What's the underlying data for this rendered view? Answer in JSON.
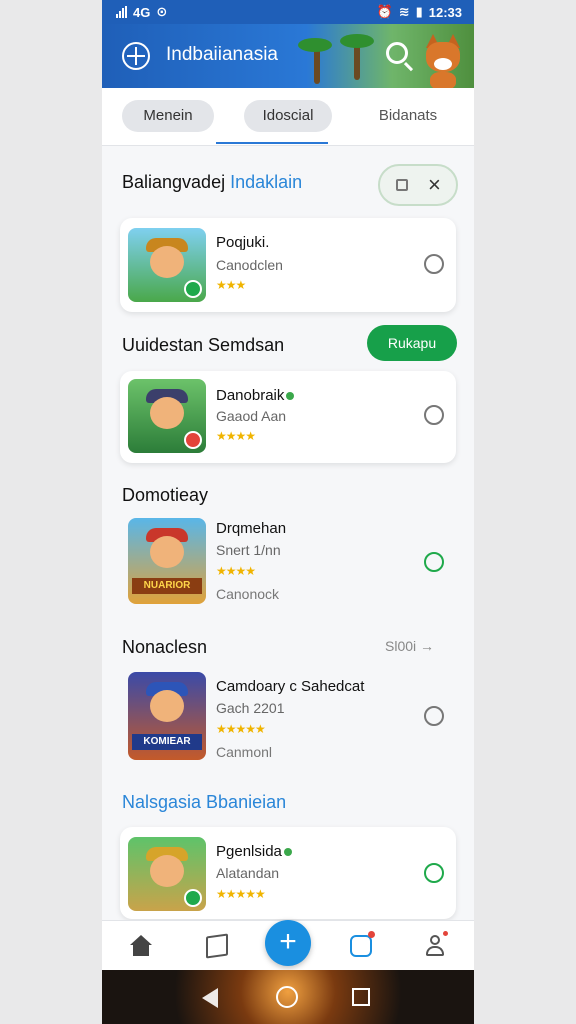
{
  "status_bar": {
    "left_text": "4G",
    "time": "12:33"
  },
  "header": {
    "title": "Indbaiianasia"
  },
  "tabs": [
    {
      "label": "Menein"
    },
    {
      "label": "Idoscial"
    },
    {
      "label": "Bidanats"
    }
  ],
  "section1": {
    "title_plain": "Baliangvadej",
    "title_accent": "Indaklain"
  },
  "section2": {
    "title": "Uuidestan Semdsan",
    "button_label": "Rukapu"
  },
  "section3": {
    "title": "Domotieay"
  },
  "section4": {
    "title": "Nonaclesn",
    "link_label": "Sl00i →"
  },
  "section5": {
    "title": "Nalsgasia Bbanieian"
  },
  "apps": [
    {
      "name": "Poqjuki.",
      "subtitle": "Canodclen",
      "stars": "★★★"
    },
    {
      "name": "Danobraik",
      "subtitle": "Gaaod Aan",
      "stars": "★★★★"
    },
    {
      "name": "Drqmehan",
      "subtitle": "Snert 1/nn",
      "stars": "★★★★",
      "meta": "Canonock",
      "banner": "NUARIOR"
    },
    {
      "name": "Camdoary c Sahedcat",
      "subtitle": "Gach 2201",
      "stars": "★★★★★",
      "meta": "Canmonl",
      "banner": "KOMIEAR"
    },
    {
      "name": "Pgenlsida",
      "subtitle": "Alatandan",
      "stars": "★★★★★"
    }
  ],
  "bottom_nav": {
    "add_label": "+"
  },
  "colors": {
    "primary": "#1f5fb8",
    "accent_green": "#17a04a",
    "fab": "#1a8fe0"
  }
}
